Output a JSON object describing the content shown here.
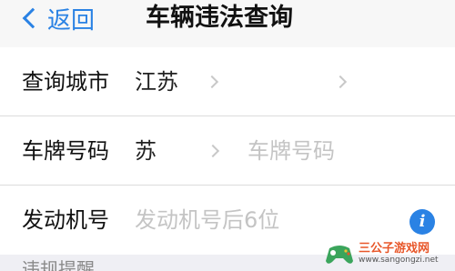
{
  "navbar": {
    "back_label": "返回",
    "title": "车辆违法查询"
  },
  "form": {
    "city": {
      "label": "查询城市",
      "value": "江苏"
    },
    "plate": {
      "label": "车牌号码",
      "prefix": "苏",
      "placeholder": "车牌号码"
    },
    "engine": {
      "label": "发动机号",
      "placeholder": "发动机号后6位",
      "info_glyph": "i"
    }
  },
  "footer": {
    "partial_text": "违规提醒"
  },
  "watermark": {
    "name": "三公子游戏网",
    "url": "www.sangongzi.net"
  },
  "colors": {
    "accent": "#2a82e4",
    "placeholder": "#c4c4c4",
    "separator": "#dcdcdc",
    "navbar_bg": "#f7f7f7"
  }
}
